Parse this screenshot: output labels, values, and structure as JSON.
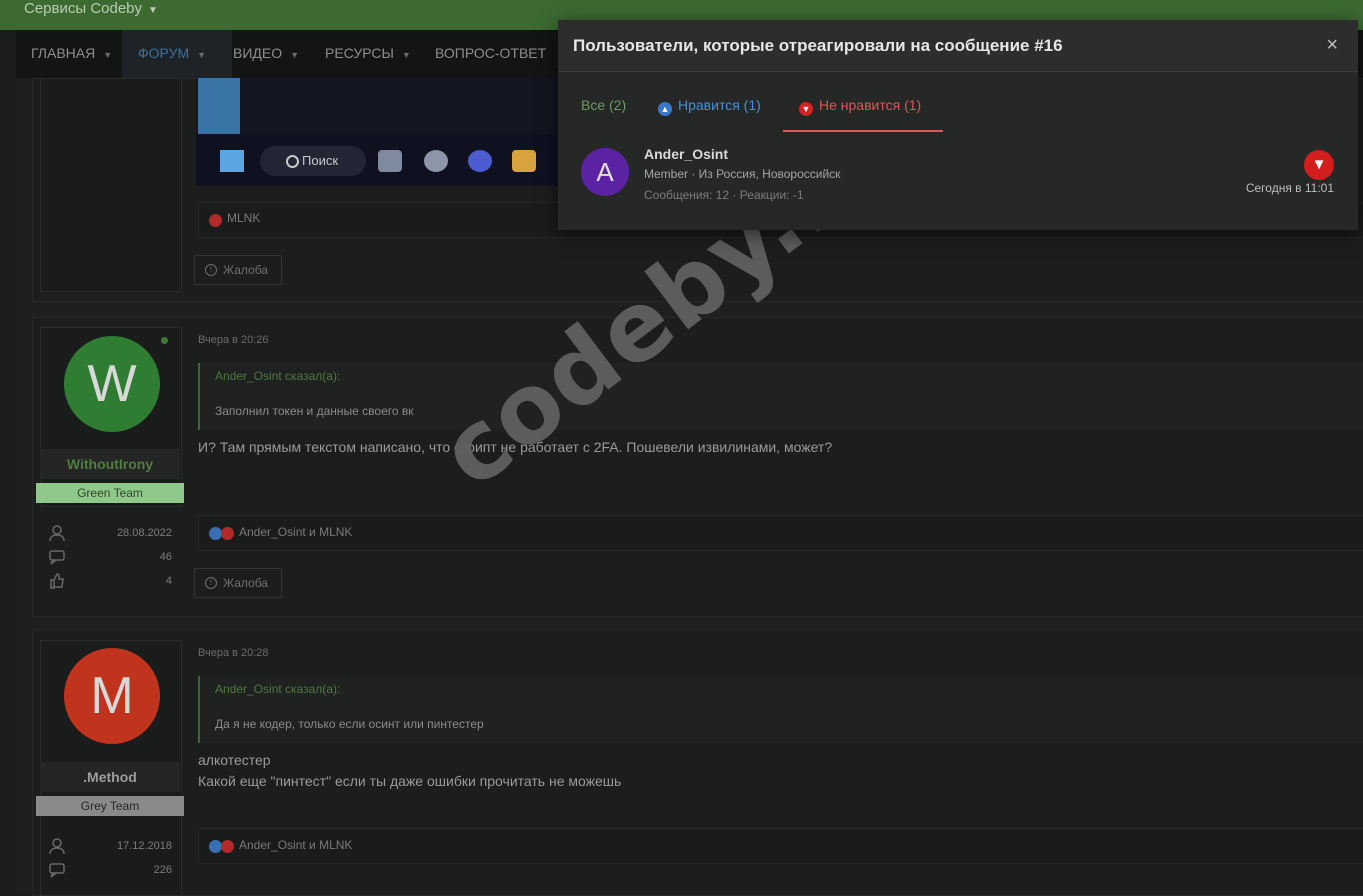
{
  "topbar": {
    "services": "Сервисы Codeby"
  },
  "nav": {
    "items": [
      {
        "label": "ГЛАВНАЯ"
      },
      {
        "label": "ФОРУМ"
      },
      {
        "label": "ВИДЕО"
      },
      {
        "label": "РЕСУРСЫ"
      },
      {
        "label": "ВОПРОС-ОТВЕТ"
      }
    ]
  },
  "first_post": {
    "screenshot": {
      "search_label": "Поиск"
    },
    "reactions_text": "MLNK",
    "report_label": "Жалоба"
  },
  "posts": [
    {
      "avatar_letter": "W",
      "username": "WithoutIrony",
      "team": "Green Team",
      "stats": {
        "joined": "28.08.2022",
        "messages": "46",
        "reactions": "4"
      },
      "date": "Вчера в 20:26",
      "quote_author": "Ander_Osint сказал(а):",
      "quote_text": "Заполнил токен и данные своего вк",
      "body": "И? Там прямым текстом написано, что скрипт не работает с 2FA. Пошевели извилинами, может?",
      "reactions_text": "Ander_Osint и MLNK",
      "report_label": "Жалоба"
    },
    {
      "avatar_letter": "M",
      "username": ".Method",
      "team": "Grey Team",
      "stats": {
        "joined": "17.12.2018",
        "messages": "226"
      },
      "date": "Вчера в 20:28",
      "quote_author": "Ander_Osint сказал(а):",
      "quote_text": "Да я не кодер, только если осинт или пинтестер",
      "body_line1": "алкотестер",
      "body_line2": "Какой еще \"пинтест\" если ты даже ошибки прочитать не можешь",
      "reactions_text": "Ander_Osint и MLNK",
      "report_label": "Жалоба"
    }
  ],
  "watermark": "codeby.net",
  "modal": {
    "title": "Пользователи, которые отреагировали на сообщение #16",
    "close_glyph": "×",
    "tabs": {
      "all": "Все (2)",
      "like": "Нравится (1)",
      "dislike": "Не нравится (1)"
    },
    "reactor": {
      "avatar_letter": "A",
      "name": "Ander_Osint",
      "meta": "Member · Из Россия, Новороссийск",
      "stats": "Сообщения: 12 · Реакции: -1",
      "time": "Сегодня в 11:01"
    }
  },
  "colors": {
    "topbar": "#3c6a31",
    "dislike": "#d41d1d",
    "like": "#3a78c8",
    "reactor_avatar": "#5b22a3",
    "avatar_w": "#2e7d32",
    "avatar_m": "#c0341d"
  },
  "icons": [
    "caret-down-icon",
    "thumbs-up-icon",
    "thumbs-down-icon",
    "user-icon",
    "chat-icon",
    "close-icon",
    "warning-icon",
    "search-icon",
    "windows-icon"
  ]
}
